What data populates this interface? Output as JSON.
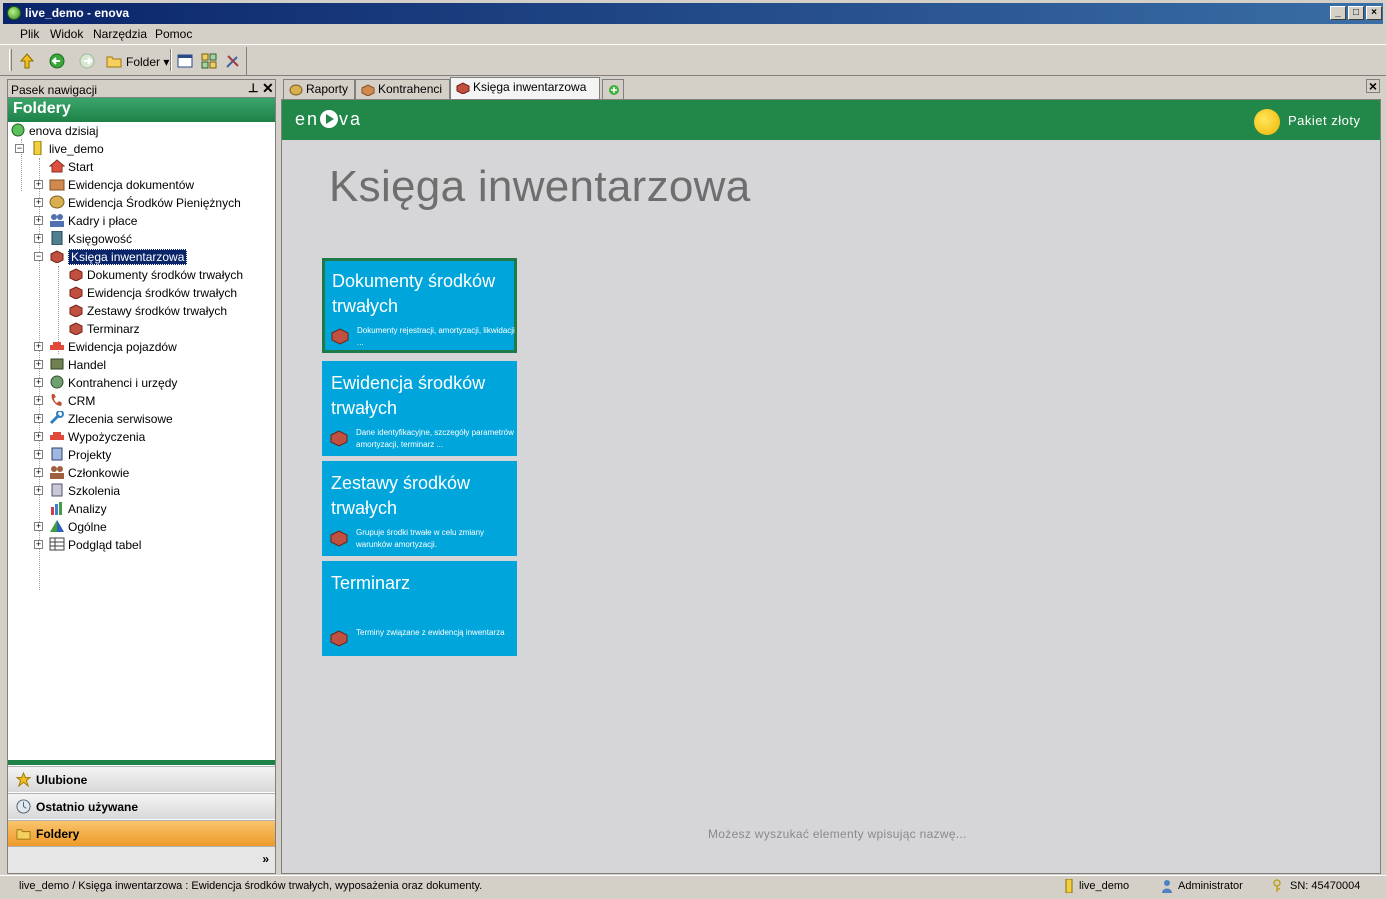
{
  "window": {
    "title": "live_demo - enova"
  },
  "menu": [
    {
      "label": "Plik",
      "key": "P"
    },
    {
      "label": "Widok",
      "key": "W"
    },
    {
      "label": "Narzędzia",
      "key": "N"
    },
    {
      "label": "Pomoc",
      "key": "o"
    }
  ],
  "toolbar": {
    "folder_label": "Folder"
  },
  "nav": {
    "header": "Pasek nawigacji",
    "section_title": "Foldery",
    "root": "enova dzisiaj",
    "db": "live_demo",
    "items": [
      {
        "label": "Start",
        "icon": "home-icon"
      },
      {
        "label": "Ewidencja dokumentów",
        "icon": "documents-icon"
      },
      {
        "label": "Ewidencja Środków Pieniężnych",
        "icon": "coins-icon"
      },
      {
        "label": "Kadry i płace",
        "icon": "people-icon"
      },
      {
        "label": "Księgowość",
        "icon": "ledger-icon"
      },
      {
        "label": "Księga inwentarzowa",
        "icon": "bricks-icon",
        "selected": true
      },
      {
        "label": "Dokumenty środków trwałych",
        "icon": "bricks-icon"
      },
      {
        "label": "Ewidencja środków trwałych",
        "icon": "bricks-icon"
      },
      {
        "label": "Zestawy środków trwałych",
        "icon": "bricks-icon"
      },
      {
        "label": "Terminarz",
        "icon": "bricks-icon"
      },
      {
        "label": "Ewidencja pojazdów",
        "icon": "car-icon"
      },
      {
        "label": "Handel",
        "icon": "cart-icon"
      },
      {
        "label": "Kontrahenci i urzędy",
        "icon": "globe-icon"
      },
      {
        "label": "CRM",
        "icon": "phone-icon"
      },
      {
        "label": "Zlecenia serwisowe",
        "icon": "wrench-icon"
      },
      {
        "label": "Wypożyczenia",
        "icon": "car-icon"
      },
      {
        "label": "Projekty",
        "icon": "project-icon"
      },
      {
        "label": "Członkowie",
        "icon": "people-icon"
      },
      {
        "label": "Szkolenia",
        "icon": "book-icon"
      },
      {
        "label": "Analizy",
        "icon": "chart-icon"
      },
      {
        "label": "Ogólne",
        "icon": "triangle-icon"
      },
      {
        "label": "Podgląd tabel",
        "icon": "table-icon"
      }
    ],
    "buttons": [
      {
        "label": "Ulubione"
      },
      {
        "label": "Ostatnio używane"
      },
      {
        "label": "Foldery"
      }
    ]
  },
  "tabs": [
    {
      "label": "Raporty"
    },
    {
      "label": "Kontrahenci"
    },
    {
      "label": "Księga inwentarzowa",
      "active": true
    }
  ],
  "brand": {
    "logo_left": "en",
    "logo_right": "va",
    "package": "Pakiet złoty"
  },
  "page": {
    "title": "Księga inwentarzowa",
    "tiles": [
      {
        "title": "Dokumenty środków trwałych",
        "desc": "Dokumenty rejestracji, amortyzacji, likwidacji ..."
      },
      {
        "title": "Ewidencja środków trwałych",
        "desc": "Dane identyfikacyjne, szczegóły parametrów amortyzacji, terminarz ..."
      },
      {
        "title": "Zestawy środków trwałych",
        "desc": "Grupuje środki trwałe w celu zmiany warunków amortyzacji."
      },
      {
        "title": "Terminarz",
        "desc": "Terminy związane z ewidencją inwentarza"
      }
    ],
    "hint": "Możesz wyszukać elementy wpisując nazwę..."
  },
  "status": {
    "path": "live_demo / Księga inwentarzowa : Ewidencja środków trwałych, wyposażenia oraz dokumenty.",
    "db": "live_demo",
    "user": "Administrator",
    "sn": "SN: 45470004"
  }
}
